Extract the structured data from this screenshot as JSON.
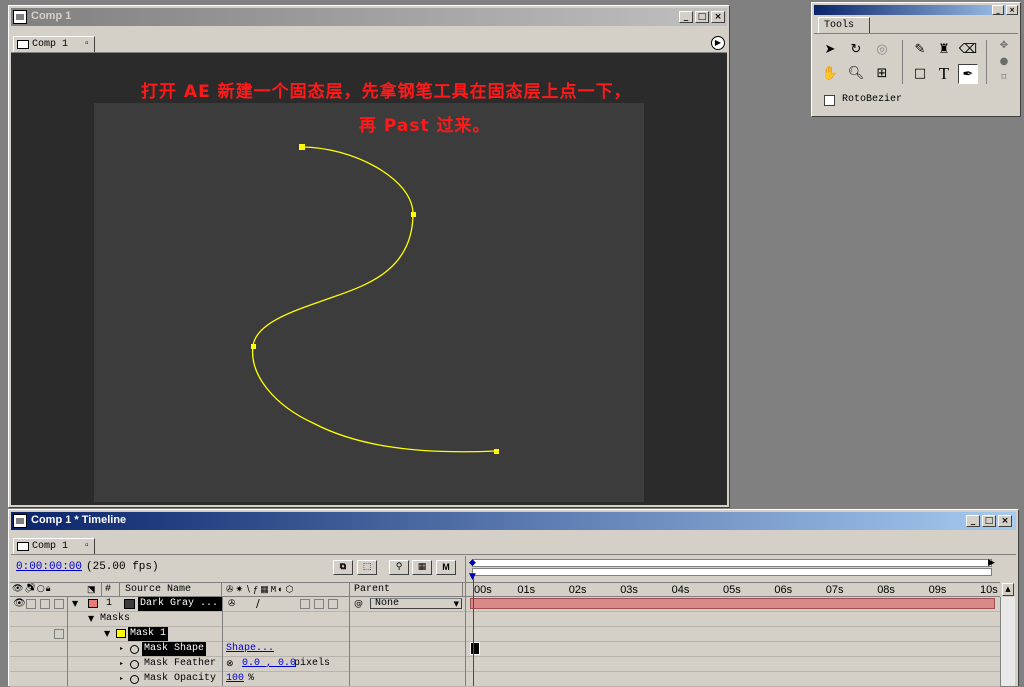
{
  "comp_window": {
    "title": "Comp 1",
    "tab_label": "Comp 1",
    "annotation_line1": "打开 AE 新建一个固态层，先拿钢笔工具在固态层上点一下，",
    "annotation_line2": "再 Past 过来。",
    "colors": {
      "viewer_bg": "#2b2b2b",
      "solid": "#3c3c3c",
      "path": "#ffff00",
      "annotation": "#ff1a1a"
    }
  },
  "tools_panel": {
    "tab_label": "Tools",
    "rotobezier_label": "RotoBezier",
    "rotobezier_checked": false,
    "icons": [
      "selection-tool-icon",
      "rotation-tool-icon",
      "orbit-camera-tool-icon",
      "brush-tool-icon",
      "clone-stamp-tool-icon",
      "eraser-tool-icon",
      "hand-tool-icon",
      "zoom-tool-icon",
      "track-xy-camera-tool-icon",
      "rectangle-mask-tool-icon",
      "text-tool-icon",
      "pen-tool-icon"
    ]
  },
  "timeline_window": {
    "title": "Comp 1 * Timeline",
    "tab_label": "Comp 1",
    "timecode": "0:00:00:00",
    "fps": "(25.00 fps)",
    "columns": {
      "index": "#",
      "source_name": "Source Name",
      "parent": "Parent"
    },
    "time_ticks": [
      "00s",
      "01s",
      "02s",
      "03s",
      "04s",
      "05s",
      "06s",
      "07s",
      "08s",
      "09s",
      "10s"
    ],
    "layer": {
      "index": "1",
      "name": "Dark Gray ...",
      "parent": "None",
      "label_color": "#e87a7a"
    },
    "masks_group": "Masks",
    "mask_name": "Mask 1",
    "mask_color": "#ffff00",
    "properties": [
      {
        "name": "Mask Shape",
        "value": "Shape...",
        "unit": ""
      },
      {
        "name": "Mask Feather",
        "value": "0.0 , 0.0",
        "unit": "pixels"
      },
      {
        "name": "Mask Opacity",
        "value": "100",
        "unit": "%"
      }
    ],
    "colors": {
      "work_bar": "#d98888",
      "playhead": "#ff0000"
    }
  }
}
